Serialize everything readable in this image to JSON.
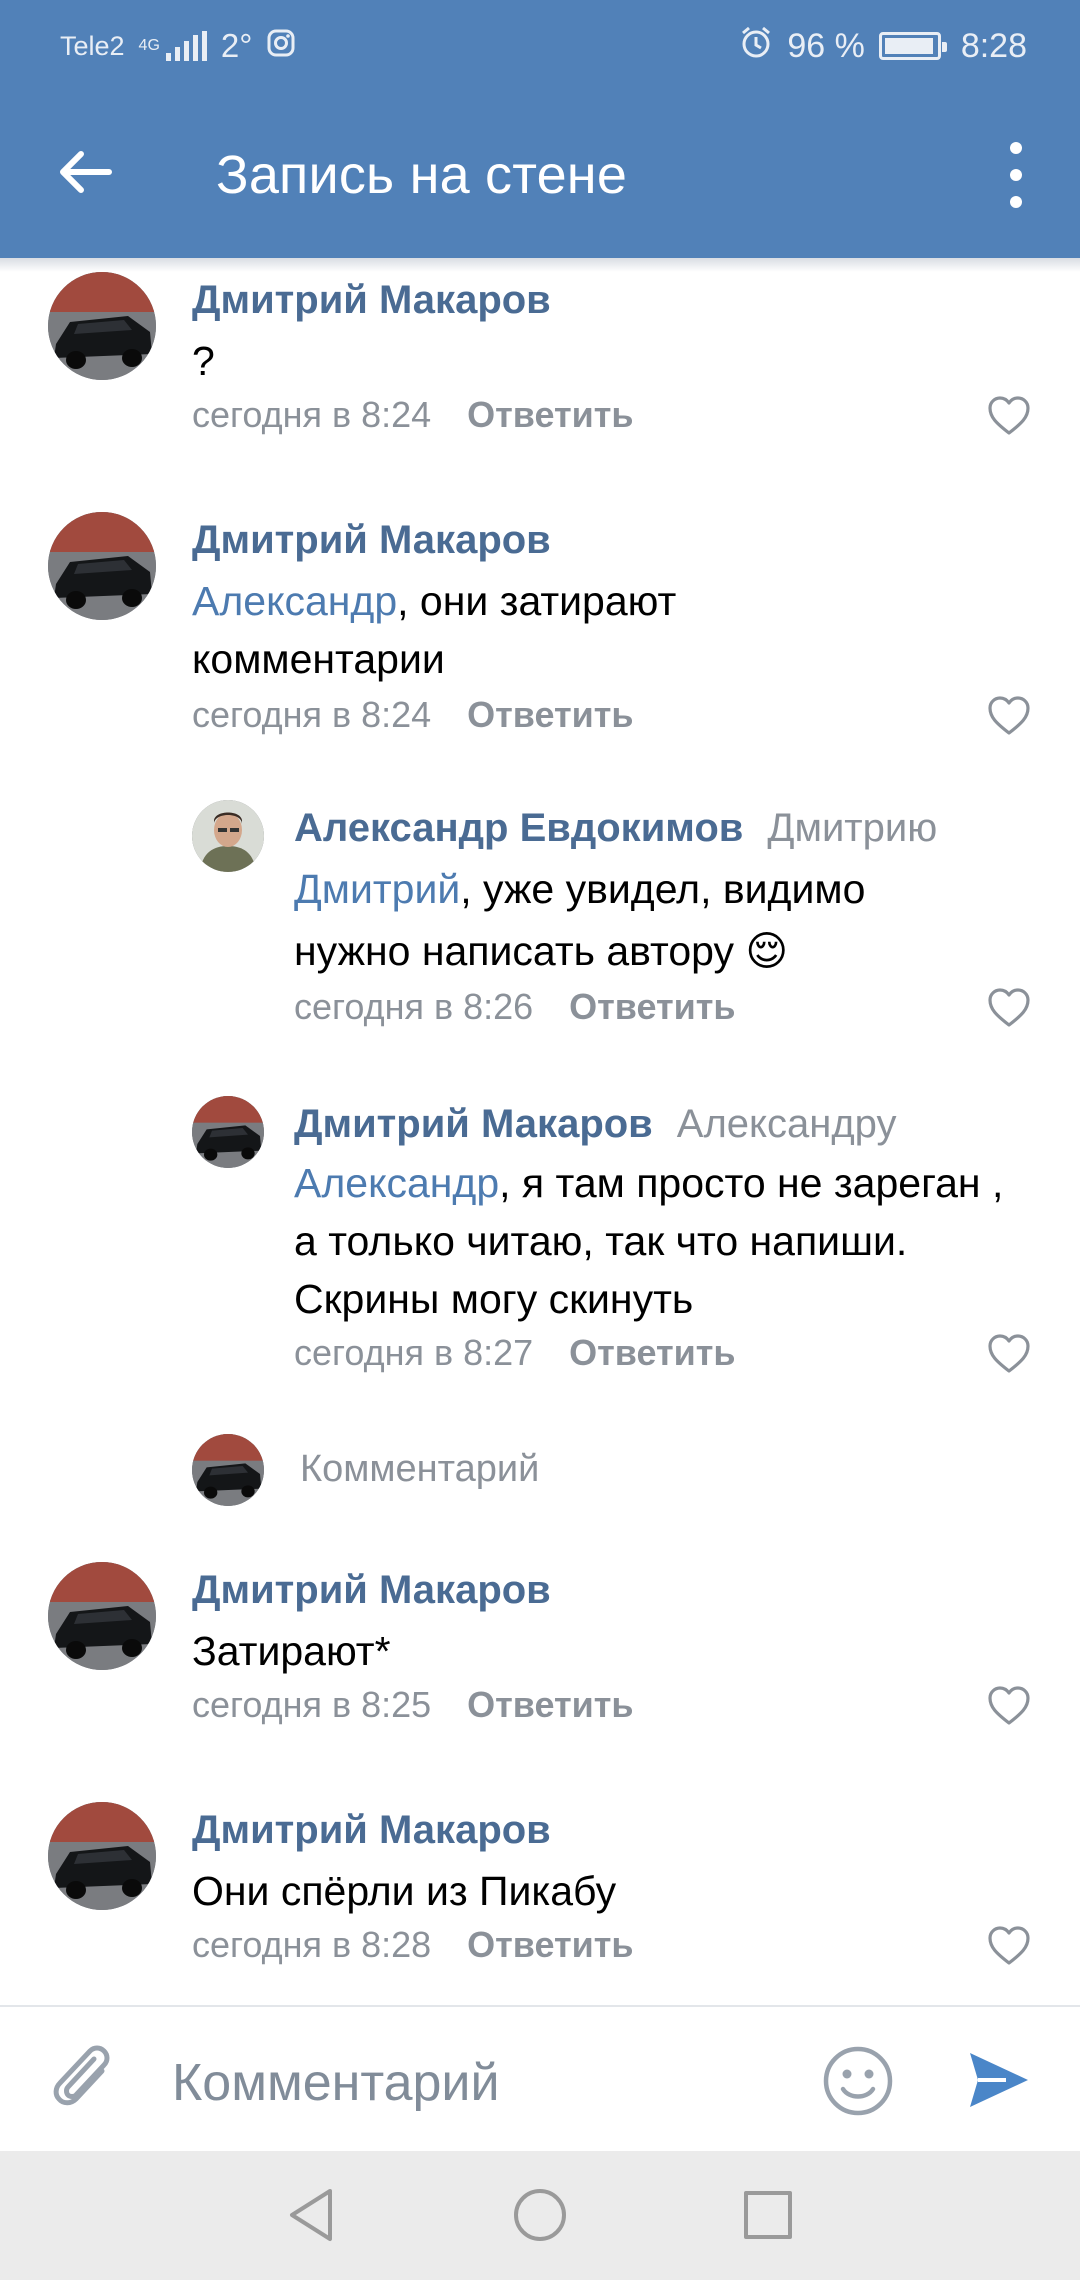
{
  "status_bar": {
    "carrier": "Tele2",
    "network": "4G",
    "temperature": "2°",
    "battery_percent": "96 %",
    "battery_level": 0.96,
    "time": "8:28"
  },
  "header": {
    "title": "Запись на стене"
  },
  "comments": [
    {
      "author": "Дмитрий Макаров",
      "reply_to": "",
      "mention": "",
      "text": "?",
      "time": "сегодня в 8:24",
      "reply_label": "Ответить"
    },
    {
      "author": "Дмитрий Макаров",
      "reply_to": "",
      "mention": "Александр",
      "text": ", они затирают комментарии",
      "time": "сегодня в 8:24",
      "reply_label": "Ответить"
    },
    {
      "author": "Александр Евдокимов",
      "reply_to": "Дмитрию",
      "mention": "Дмитрий",
      "text": ", уже увидел, видимо нужно написать автору 😌",
      "time": "сегодня в 8:26",
      "reply_label": "Ответить"
    },
    {
      "author": "Дмитрий Макаров",
      "reply_to": "Александру",
      "mention": "Александр",
      "text": ", я там просто не зареган , а только читаю, так что напиши. Скрины могу скинуть",
      "time": "сегодня в 8:27",
      "reply_label": "Ответить"
    },
    {
      "author": "Дмитрий Макаров",
      "reply_to": "",
      "mention": "",
      "text": "Затирают*",
      "time": "сегодня в 8:25",
      "reply_label": "Ответить"
    },
    {
      "author": "Дмитрий Макаров",
      "reply_to": "",
      "mention": "",
      "text": "Они спёрли из Пикабу",
      "time": "сегодня в 8:28",
      "reply_label": "Ответить"
    }
  ],
  "thread_reply": {
    "placeholder": "Комментарий"
  },
  "input_bar": {
    "placeholder": "Комментарий"
  },
  "icons": {
    "back": "arrow-left-icon",
    "menu": "more-vertical-icon",
    "like": "heart-outline-icon",
    "attach": "paperclip-icon",
    "emoji": "smile-icon",
    "send": "send-icon"
  },
  "colors": {
    "header": "#5181b8",
    "author": "#4a6b93",
    "mention": "#4d7bb0",
    "muted": "#8b9199",
    "send": "#4a86c8"
  }
}
